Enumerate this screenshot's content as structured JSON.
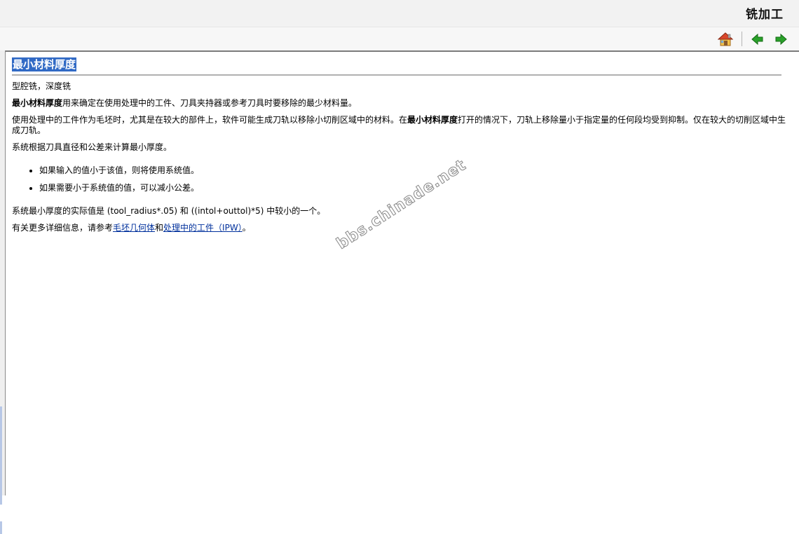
{
  "header": {
    "title": "铣加工"
  },
  "nav": {
    "home_icon": "home-icon",
    "back_icon": "back-arrow-icon",
    "forward_icon": "forward-arrow-icon"
  },
  "article": {
    "title": "最小材料厚度",
    "subtitle": "型腔铣，深度铣",
    "p1_bold": "最小材料厚度",
    "p1_rest": "用来确定在使用处理中的工件、刀具夹持器或参考刀具时要移除的最少材料量。",
    "p2_a": "使用处理中的工件作为毛坯时，尤其是在较大的部件上，软件可能生成刀轨以移除小切削区域中的材料。在",
    "p2_bold": "最小材料厚度",
    "p2_b": "打开的情况下，刀轨上移除量小于指定量的任何段均受到抑制。仅在较大的切削区域中生成刀轨。",
    "p3": "系统根据刀具直径和公差来计算最小厚度。",
    "bullets": [
      "如果输入的值小于该值，则将使用系统值。",
      "如果需要小于系统值的值，可以减小公差。"
    ],
    "p4": "系统最小厚度的实际值是 (tool_radius*.05) 和 ((intol+outtol)*5) 中较小的一个。",
    "p5_a": "有关更多详细信息，请参考",
    "p5_link1": "毛坯几何体",
    "p5_and": "和",
    "p5_link2": "处理中的工件（IPW）",
    "p5_end": "。"
  },
  "watermark": "bbs.chinade.net",
  "colors": {
    "link": "#00309c",
    "title_highlight": "#316ac5"
  }
}
